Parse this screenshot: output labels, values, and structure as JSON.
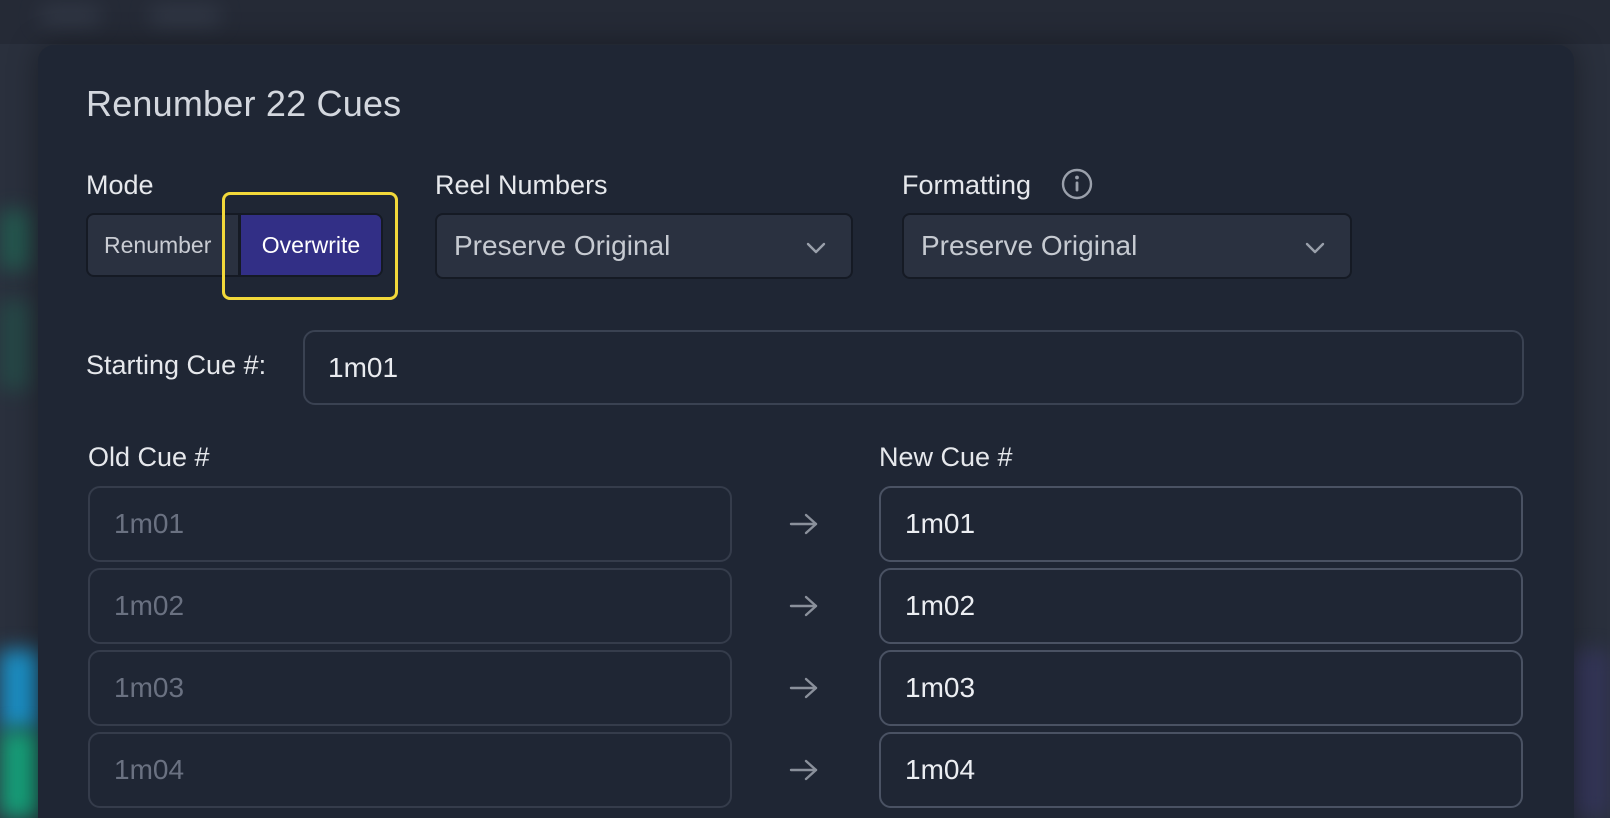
{
  "dialog": {
    "title": "Renumber 22 Cues"
  },
  "mode": {
    "label": "Mode",
    "options": [
      "Renumber",
      "Overwrite"
    ],
    "selected": "Overwrite"
  },
  "reel_numbers": {
    "label": "Reel Numbers",
    "value": "Preserve Original"
  },
  "formatting": {
    "label": "Formatting",
    "value": "Preserve Original",
    "info_icon": "info-icon"
  },
  "starting_cue": {
    "label": "Starting Cue #:",
    "value": "1m01"
  },
  "columns": {
    "old": "Old Cue #",
    "new": "New Cue #"
  },
  "rows": [
    {
      "old": "1m01",
      "new": "1m01"
    },
    {
      "old": "1m02",
      "new": "1m02"
    },
    {
      "old": "1m03",
      "new": "1m03"
    },
    {
      "old": "1m04",
      "new": "1m04"
    }
  ],
  "colors": {
    "accent": "#322f86",
    "highlight": "#f2d83a",
    "dialog_bg": "#1f2634"
  }
}
